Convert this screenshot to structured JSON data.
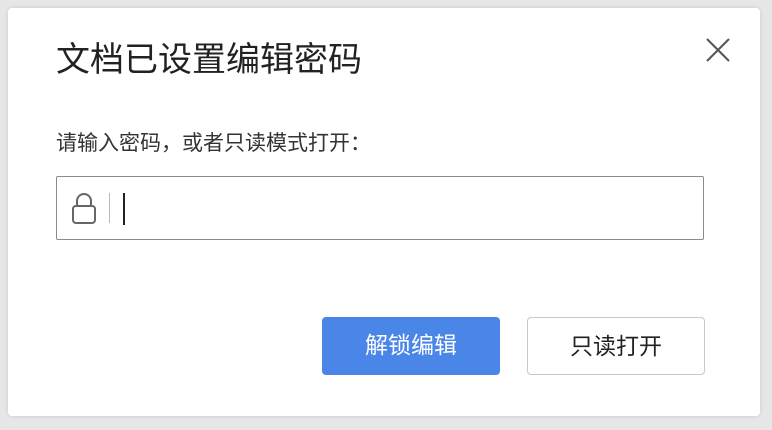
{
  "dialog": {
    "title": "文档已设置编辑密码",
    "prompt": "请输入密码，或者只读模式打开：",
    "password_field": {
      "value": "",
      "placeholder": ""
    },
    "buttons": {
      "unlock_edit": "解锁编辑",
      "read_only_open": "只读打开"
    },
    "icons": {
      "close": "close-icon",
      "lock": "lock-icon"
    },
    "colors": {
      "primary_button": "#4a86e8"
    }
  }
}
